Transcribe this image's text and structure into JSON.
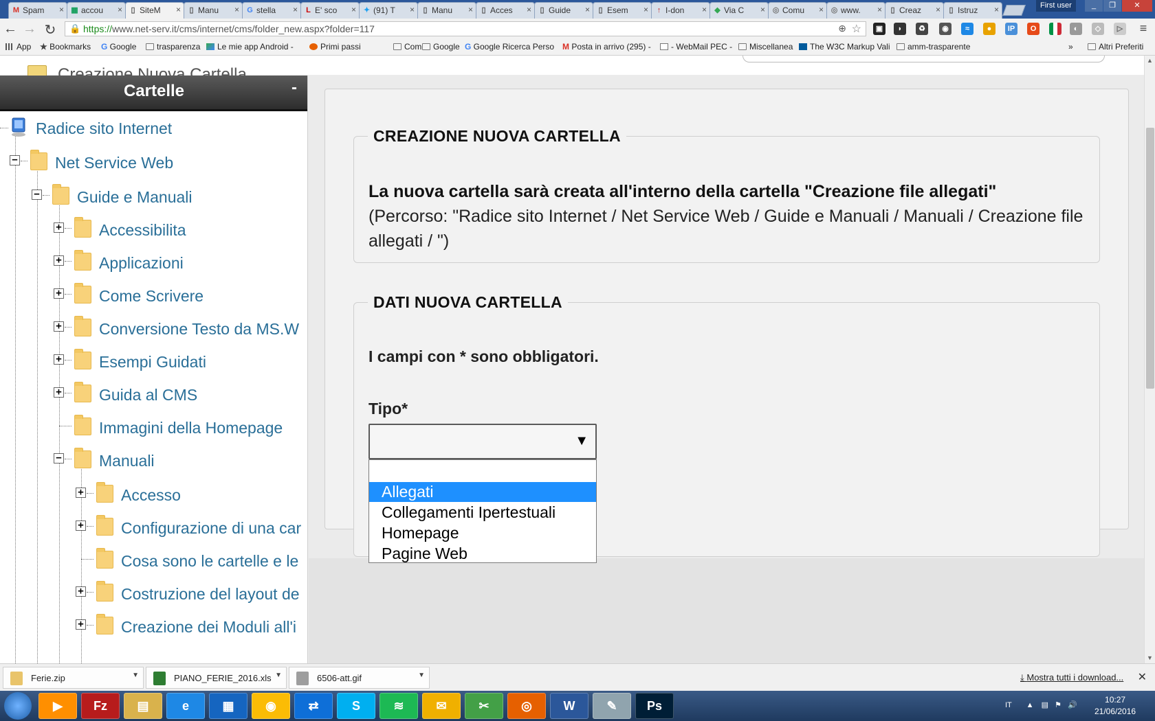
{
  "browser": {
    "tabs": [
      {
        "label": "Spam",
        "icon": "gmail-icon"
      },
      {
        "label": "accou",
        "icon": "sheets-icon"
      },
      {
        "label": "SiteM",
        "icon": "page-icon",
        "active": true
      },
      {
        "label": "Manu",
        "icon": "page-icon"
      },
      {
        "label": "stella",
        "icon": "google-icon"
      },
      {
        "label": "E' sco",
        "icon": "li-icon"
      },
      {
        "label": "(91) T",
        "icon": "twitter-icon"
      },
      {
        "label": "Manu",
        "icon": "page-icon"
      },
      {
        "label": "Acces",
        "icon": "page-icon"
      },
      {
        "label": "Guide",
        "icon": "page-icon"
      },
      {
        "label": "Esem",
        "icon": "page-icon"
      },
      {
        "label": "I-don",
        "icon": "idon-icon"
      },
      {
        "label": "Via C",
        "icon": "maps-icon"
      },
      {
        "label": "Comu",
        "icon": "crest-icon"
      },
      {
        "label": "www.",
        "icon": "crest-icon"
      },
      {
        "label": "Creaz",
        "icon": "page-icon"
      },
      {
        "label": "Istruz",
        "icon": "page-icon"
      }
    ],
    "first_user": "First user",
    "url_scheme": "https://",
    "url_rest": "www.net-serv.it/cms/internet/cms/folder_new.aspx?folder=117",
    "bookmarks": [
      {
        "label": "App",
        "icon": "apps-icon"
      },
      {
        "label": "Bookmarks",
        "icon": "star-icon"
      },
      {
        "label": "Google",
        "icon": "google-icon"
      },
      {
        "label": "trasparenza",
        "icon": "folder-icon"
      },
      {
        "label": "Le mie app Android -",
        "icon": "play-icon"
      },
      {
        "label": "Primi passi",
        "icon": "firefox-icon"
      },
      {
        "label": "Comct",
        "icon": "folder-icon"
      },
      {
        "label": "Google",
        "icon": "folder-icon"
      },
      {
        "label": "Google Ricerca Perso",
        "icon": "google-icon"
      },
      {
        "label": "Posta in arrivo (295) -",
        "icon": "gmail-icon"
      },
      {
        "label": "- WebMail PEC -",
        "icon": "page-icon"
      },
      {
        "label": "Miscellanea",
        "icon": "folder-icon"
      },
      {
        "label": "The W3C Markup Vali",
        "icon": "w3c-icon"
      },
      {
        "label": "amm-trasparente",
        "icon": "folder-icon"
      }
    ],
    "more_bookmarks": "»",
    "other_bookmarks": "Altri Preferiti"
  },
  "page": {
    "header_title": "Creazione Nuova Cartella",
    "sidebar": {
      "title": "Cartelle",
      "collapse": "-",
      "tree": [
        {
          "label": "Radice sito Internet",
          "level": 0,
          "toggle": "none",
          "root": true
        },
        {
          "label": "Net Service Web",
          "level": 1,
          "toggle": "minus"
        },
        {
          "label": "Guide e Manuali",
          "level": 2,
          "toggle": "minus"
        },
        {
          "label": "Accessibilita",
          "level": 3,
          "toggle": "plus"
        },
        {
          "label": "Applicazioni",
          "level": 3,
          "toggle": "plus"
        },
        {
          "label": "Come Scrivere",
          "level": 3,
          "toggle": "plus"
        },
        {
          "label": "Conversione Testo da MS.W",
          "level": 3,
          "toggle": "plus"
        },
        {
          "label": "Esempi Guidati",
          "level": 3,
          "toggle": "plus"
        },
        {
          "label": "Guida al CMS",
          "level": 3,
          "toggle": "plus"
        },
        {
          "label": "Immagini della Homepage",
          "level": 3,
          "toggle": "none"
        },
        {
          "label": "Manuali",
          "level": 3,
          "toggle": "minus"
        },
        {
          "label": "Accesso",
          "level": 4,
          "toggle": "plus"
        },
        {
          "label": "Configurazione di una car",
          "level": 4,
          "toggle": "plus"
        },
        {
          "label": "Cosa sono le cartelle e le",
          "level": 4,
          "toggle": "none"
        },
        {
          "label": "Costruzione del layout de",
          "level": 4,
          "toggle": "plus"
        },
        {
          "label": "Creazione dei Moduli all'i",
          "level": 4,
          "toggle": "plus"
        }
      ]
    },
    "section1": {
      "legend": "CREAZIONE NUOVA CARTELLA",
      "bold_text": "La nuova cartella sarà creata all'interno della cartella \"Creazione file allegati\"",
      "path_text": "(Percorso: \"Radice sito Internet / Net Service Web / Guide e Manuali / Manuali / Creazione file allegati / \")"
    },
    "section2": {
      "legend": "DATI NUOVA CARTELLA",
      "required_note": "I campi con * sono obbligatori.",
      "tipo_label": "Tipo*",
      "tipo_value": "",
      "dropdown_arrow": "▼",
      "options": [
        "",
        "Allegati",
        "Collegamenti Ipertestuali",
        "Homepage",
        "Pagine Web"
      ],
      "highlighted_option": "Allegati"
    }
  },
  "downloads": {
    "items": [
      "Ferie.zip",
      "PIANO_FERIE_2016.xls",
      "6506-att.gif"
    ],
    "show_all": "Mostra tutti i download...",
    "close": "✕"
  },
  "taskbar": {
    "apps": [
      "media-player-icon",
      "filezilla-icon",
      "explorer-icon",
      "ie-icon",
      "apps-icon",
      "chrome-icon",
      "teamviewer-icon",
      "skype-icon",
      "spotify-icon",
      "outlook-icon",
      "greenshot-icon",
      "firefox-icon",
      "word-icon",
      "notepad-icon",
      "photoshop-icon"
    ],
    "lang": "IT",
    "time": "10:27",
    "date": "21/06/2016"
  }
}
